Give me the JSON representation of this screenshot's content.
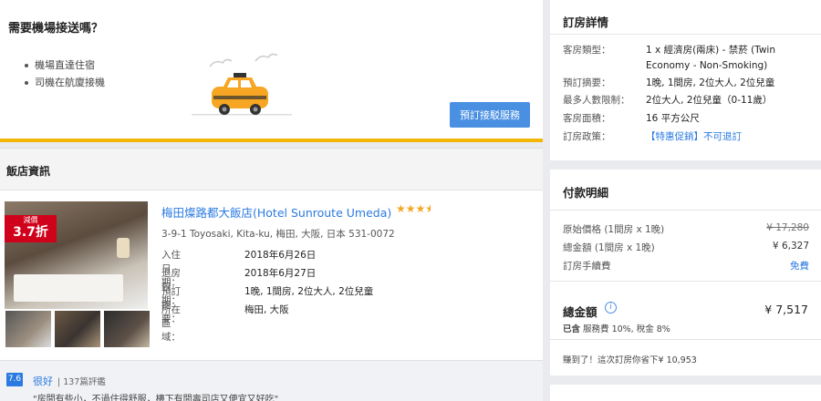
{
  "transfer": {
    "title": "需要機場接送嗎？",
    "bullets": [
      "機場直達住宿",
      "司機在航廈接機"
    ],
    "button_label": "預訂接駁服務"
  },
  "hotel": {
    "section_title": "飯店資訊",
    "badge_top": "減價",
    "badge_value": "3.7折",
    "name": "梅田燦路都大飯店(Hotel Sunroute Umeda)",
    "stars": "★★★",
    "half_star": "★",
    "address": "3-9-1 Toyosaki, Kita-ku, 梅田, 大阪, 日本 531-0072",
    "info": [
      {
        "key": "入住日期：",
        "value": "2018年6月26日"
      },
      {
        "key": "退房日期：",
        "value": "2018年6月27日"
      },
      {
        "key": "預訂摘要：",
        "value": "1晚, 1間房, 2位大人, 2位兒童"
      },
      {
        "key": "所在區域：",
        "value": "梅田, 大阪"
      }
    ],
    "review": {
      "score": "7.6",
      "word": "很好",
      "count": "| 137篇評鑑",
      "quote": "\"房間有些小，不過住得舒服，樓下有間壽司店又便宜又好吃\""
    }
  },
  "booking_details": {
    "title": "訂房詳情",
    "rows": [
      {
        "key": "客房類型：",
        "value": "1 x 經濟房(兩床) - 禁菸 (Twin Economy - Non-Smoking)"
      },
      {
        "key": "預訂摘要：",
        "value": "1晚, 1間房, 2位大人, 2位兒童"
      },
      {
        "key": "最多人數限制：",
        "value": "2位大人, 2位兒童（0-11歲）"
      },
      {
        "key": "客房面積：",
        "value": "16 平方公尺"
      },
      {
        "key": "訂房政策：",
        "value": "【特惠促銷】不可退訂"
      }
    ]
  },
  "payment": {
    "title": "付款明細",
    "rows": [
      {
        "key": "原始價格 (1間房 x 1晚)",
        "value": "¥ 17,280"
      },
      {
        "key": "總金額 (1間房 x 1晚)",
        "value": "¥ 6,327"
      },
      {
        "key": "訂房手續費",
        "value": "免費"
      }
    ],
    "total_label": "總金額",
    "total_value": "¥ 7,517",
    "included_prefix": "已含",
    "included_text": "服務費 10%, 稅金 8%",
    "saved_text": "賺到了！這次訂房你省下¥ 10,953"
  },
  "colors": {
    "accent_blue": "#4a90e2",
    "link_blue": "#2a7ae2",
    "badge_red": "#d0021b",
    "yellow_bar": "#f2b705",
    "star": "#f5a623"
  }
}
